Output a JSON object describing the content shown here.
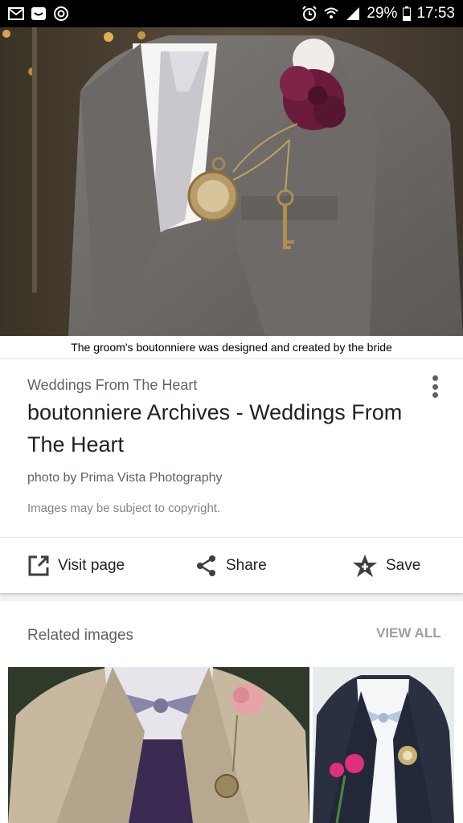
{
  "status_bar": {
    "left_icons": [
      "gmail-icon",
      "messenger-icon",
      "sync-icon"
    ],
    "battery": "29%",
    "time": "17:53"
  },
  "hero": {
    "caption": "The groom's boutonniere was designed and created by the bride"
  },
  "result": {
    "site_name": "Weddings From The Heart",
    "title": "boutonniere Archives - Weddings From The Heart",
    "credit": "photo by Prima Vista Photography",
    "copyright": "Images may be subject to copyright."
  },
  "actions": {
    "visit_label": "Visit page",
    "share_label": "Share",
    "save_label": "Save"
  },
  "related": {
    "heading": "Related images",
    "view_all": "VIEW ALL"
  },
  "colors": {
    "status_bar_bg": "#000000",
    "text_primary": "#212121",
    "text_secondary": "#5f6368",
    "view_all": "#9aa0a6"
  }
}
